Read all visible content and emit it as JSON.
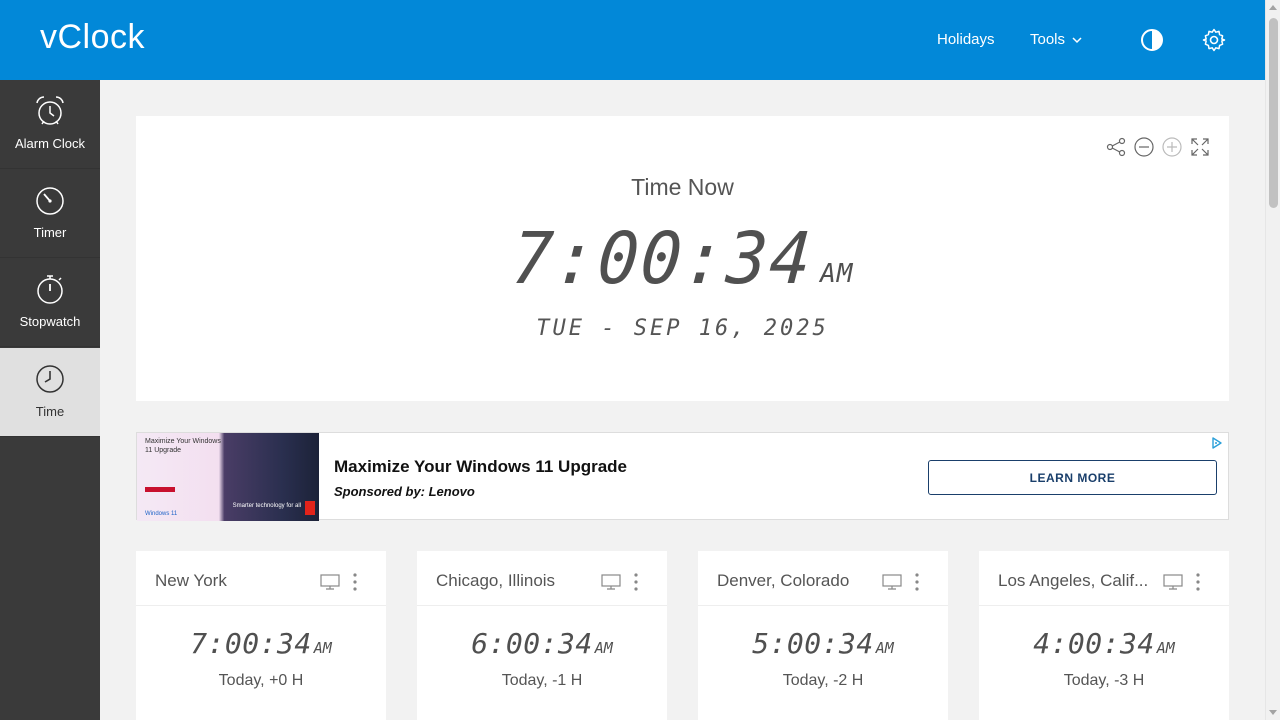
{
  "header": {
    "logo": "vClock",
    "nav": [
      {
        "label": "Holidays"
      },
      {
        "label": "Tools"
      }
    ],
    "icons": [
      "contrast-icon",
      "gear-icon"
    ],
    "accent_color": "#0288d8"
  },
  "sidebar": {
    "items": [
      {
        "label": "Alarm Clock",
        "icon": "alarm-clock-icon",
        "active": false
      },
      {
        "label": "Timer",
        "icon": "timer-icon",
        "active": false
      },
      {
        "label": "Stopwatch",
        "icon": "stopwatch-icon",
        "active": false
      },
      {
        "label": "Time",
        "icon": "clock-icon",
        "active": true
      }
    ]
  },
  "clock": {
    "heading": "Time Now",
    "time": "7:00:34",
    "ampm": "AM",
    "date": "TUE - SEP 16, 2025",
    "tools": [
      "share-icon",
      "zoom-out-icon",
      "zoom-in-icon",
      "fullscreen-icon"
    ]
  },
  "ad": {
    "title": "Maximize Your Windows 11 Upgrade",
    "sponsor": "Sponsored by: Lenovo",
    "button": "LEARN MORE",
    "image_text": "Maximize Your Windows 11 Upgrade",
    "image_brand": "Windows 11",
    "image_tagline": "Smarter technology for all"
  },
  "cities": [
    {
      "name": "New York",
      "time": "7:00:34",
      "ampm": "AM",
      "offset": "Today, +0 H"
    },
    {
      "name": "Chicago, Illinois",
      "time": "6:00:34",
      "ampm": "AM",
      "offset": "Today, -1 H"
    },
    {
      "name": "Denver, Colorado",
      "time": "5:00:34",
      "ampm": "AM",
      "offset": "Today, -2 H"
    },
    {
      "name": "Los Angeles, Calif...",
      "time": "4:00:34",
      "ampm": "AM",
      "offset": "Today, -3 H"
    }
  ]
}
